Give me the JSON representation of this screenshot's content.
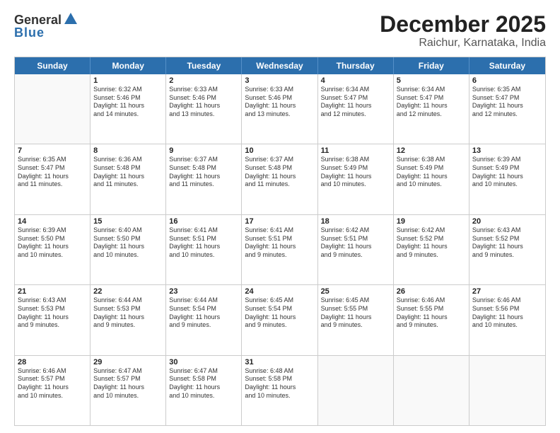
{
  "header": {
    "logo_general": "General",
    "logo_blue": "Blue",
    "month": "December 2025",
    "location": "Raichur, Karnataka, India"
  },
  "days_of_week": [
    "Sunday",
    "Monday",
    "Tuesday",
    "Wednesday",
    "Thursday",
    "Friday",
    "Saturday"
  ],
  "weeks": [
    [
      {
        "day": "",
        "info": ""
      },
      {
        "day": "1",
        "info": "Sunrise: 6:32 AM\nSunset: 5:46 PM\nDaylight: 11 hours\nand 14 minutes."
      },
      {
        "day": "2",
        "info": "Sunrise: 6:33 AM\nSunset: 5:46 PM\nDaylight: 11 hours\nand 13 minutes."
      },
      {
        "day": "3",
        "info": "Sunrise: 6:33 AM\nSunset: 5:46 PM\nDaylight: 11 hours\nand 13 minutes."
      },
      {
        "day": "4",
        "info": "Sunrise: 6:34 AM\nSunset: 5:47 PM\nDaylight: 11 hours\nand 12 minutes."
      },
      {
        "day": "5",
        "info": "Sunrise: 6:34 AM\nSunset: 5:47 PM\nDaylight: 11 hours\nand 12 minutes."
      },
      {
        "day": "6",
        "info": "Sunrise: 6:35 AM\nSunset: 5:47 PM\nDaylight: 11 hours\nand 12 minutes."
      }
    ],
    [
      {
        "day": "7",
        "info": "Sunrise: 6:35 AM\nSunset: 5:47 PM\nDaylight: 11 hours\nand 11 minutes."
      },
      {
        "day": "8",
        "info": "Sunrise: 6:36 AM\nSunset: 5:48 PM\nDaylight: 11 hours\nand 11 minutes."
      },
      {
        "day": "9",
        "info": "Sunrise: 6:37 AM\nSunset: 5:48 PM\nDaylight: 11 hours\nand 11 minutes."
      },
      {
        "day": "10",
        "info": "Sunrise: 6:37 AM\nSunset: 5:48 PM\nDaylight: 11 hours\nand 11 minutes."
      },
      {
        "day": "11",
        "info": "Sunrise: 6:38 AM\nSunset: 5:49 PM\nDaylight: 11 hours\nand 10 minutes."
      },
      {
        "day": "12",
        "info": "Sunrise: 6:38 AM\nSunset: 5:49 PM\nDaylight: 11 hours\nand 10 minutes."
      },
      {
        "day": "13",
        "info": "Sunrise: 6:39 AM\nSunset: 5:49 PM\nDaylight: 11 hours\nand 10 minutes."
      }
    ],
    [
      {
        "day": "14",
        "info": "Sunrise: 6:39 AM\nSunset: 5:50 PM\nDaylight: 11 hours\nand 10 minutes."
      },
      {
        "day": "15",
        "info": "Sunrise: 6:40 AM\nSunset: 5:50 PM\nDaylight: 11 hours\nand 10 minutes."
      },
      {
        "day": "16",
        "info": "Sunrise: 6:41 AM\nSunset: 5:51 PM\nDaylight: 11 hours\nand 10 minutes."
      },
      {
        "day": "17",
        "info": "Sunrise: 6:41 AM\nSunset: 5:51 PM\nDaylight: 11 hours\nand 9 minutes."
      },
      {
        "day": "18",
        "info": "Sunrise: 6:42 AM\nSunset: 5:51 PM\nDaylight: 11 hours\nand 9 minutes."
      },
      {
        "day": "19",
        "info": "Sunrise: 6:42 AM\nSunset: 5:52 PM\nDaylight: 11 hours\nand 9 minutes."
      },
      {
        "day": "20",
        "info": "Sunrise: 6:43 AM\nSunset: 5:52 PM\nDaylight: 11 hours\nand 9 minutes."
      }
    ],
    [
      {
        "day": "21",
        "info": "Sunrise: 6:43 AM\nSunset: 5:53 PM\nDaylight: 11 hours\nand 9 minutes."
      },
      {
        "day": "22",
        "info": "Sunrise: 6:44 AM\nSunset: 5:53 PM\nDaylight: 11 hours\nand 9 minutes."
      },
      {
        "day": "23",
        "info": "Sunrise: 6:44 AM\nSunset: 5:54 PM\nDaylight: 11 hours\nand 9 minutes."
      },
      {
        "day": "24",
        "info": "Sunrise: 6:45 AM\nSunset: 5:54 PM\nDaylight: 11 hours\nand 9 minutes."
      },
      {
        "day": "25",
        "info": "Sunrise: 6:45 AM\nSunset: 5:55 PM\nDaylight: 11 hours\nand 9 minutes."
      },
      {
        "day": "26",
        "info": "Sunrise: 6:46 AM\nSunset: 5:55 PM\nDaylight: 11 hours\nand 9 minutes."
      },
      {
        "day": "27",
        "info": "Sunrise: 6:46 AM\nSunset: 5:56 PM\nDaylight: 11 hours\nand 10 minutes."
      }
    ],
    [
      {
        "day": "28",
        "info": "Sunrise: 6:46 AM\nSunset: 5:57 PM\nDaylight: 11 hours\nand 10 minutes."
      },
      {
        "day": "29",
        "info": "Sunrise: 6:47 AM\nSunset: 5:57 PM\nDaylight: 11 hours\nand 10 minutes."
      },
      {
        "day": "30",
        "info": "Sunrise: 6:47 AM\nSunset: 5:58 PM\nDaylight: 11 hours\nand 10 minutes."
      },
      {
        "day": "31",
        "info": "Sunrise: 6:48 AM\nSunset: 5:58 PM\nDaylight: 11 hours\nand 10 minutes."
      },
      {
        "day": "",
        "info": ""
      },
      {
        "day": "",
        "info": ""
      },
      {
        "day": "",
        "info": ""
      }
    ]
  ]
}
